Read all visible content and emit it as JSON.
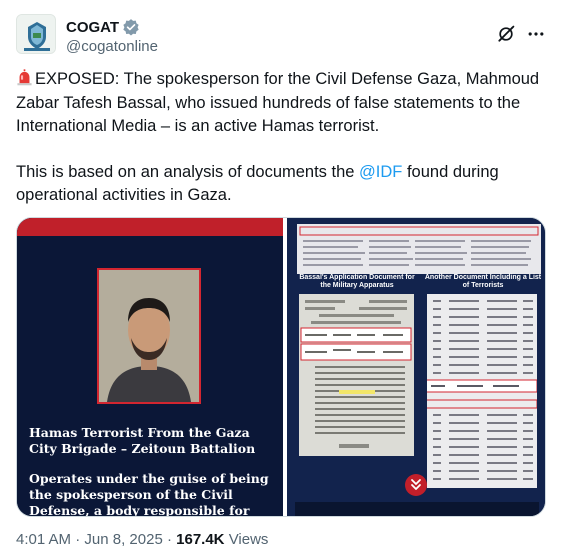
{
  "author": {
    "display_name": "COGAT",
    "handle": "@cogatonline",
    "verified": true,
    "avatar_icon": "cogat-emblem-icon"
  },
  "header_actions": {
    "grok_icon": "grok-icon",
    "more_icon": "more-icon"
  },
  "tweet": {
    "line1_emoji": "rotating-light-icon",
    "line1": "EXPOSED: The spokesperson for the Civil Defense Gaza, Mahmoud Zabar Tafesh Bassal, who issued hundreds of false statements to the International Media – is an active Hamas terrorist.",
    "line2_before": "This is based on an analysis of documents the ",
    "line2_mention": "@IDF",
    "line2_after": " found during operational activities in Gaza."
  },
  "media": {
    "left": {
      "caption_title": "Hamas Terrorist From the Gaza City Brigade – Zeitoun Battalion",
      "caption_body": "Operates under the guise of being the spokesperson of the Civil Defense, a body responsible for issuing statements"
    },
    "right": {
      "label_left": "Bassal's Application Document for the Military Apparatus",
      "label_right": "Another Document Including a List of Terrorists"
    }
  },
  "meta": {
    "time": "4:01 AM",
    "separator": "·",
    "date": "Jun 8, 2025",
    "views_count": "167.4K",
    "views_label": "Views"
  },
  "colors": {
    "accent": "#1d9bf0",
    "verified": "#829aab",
    "text": "#0f1419",
    "secondary": "#536471",
    "media_navy": "#0b1737",
    "media_red": "#c0202a"
  }
}
